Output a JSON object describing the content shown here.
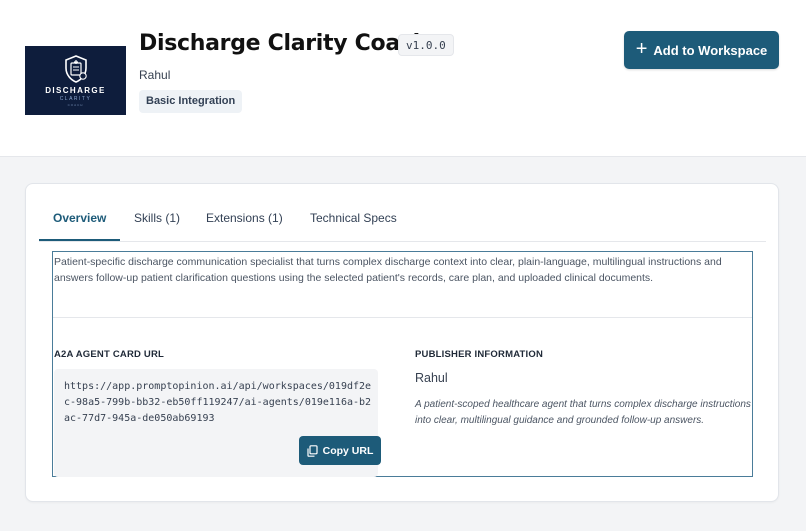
{
  "header": {
    "logo": {
      "line1": "DISCHARGE",
      "line2": "CLARITY",
      "line3": "COACH",
      "icon": "shield-document-icon"
    },
    "title": "Discharge Clarity Coach",
    "version": "v1.0.0",
    "author": "Rahul",
    "integration_badge": "Basic Integration",
    "add_button": {
      "label": "Add to Workspace",
      "icon": "plus-icon"
    }
  },
  "tabs": [
    {
      "label": "Overview",
      "active": true
    },
    {
      "label": "Skills (1)",
      "active": false
    },
    {
      "label": "Extensions (1)",
      "active": false
    },
    {
      "label": "Technical Specs",
      "active": false
    }
  ],
  "overview": {
    "description": "Patient-specific discharge communication specialist that turns complex discharge context into clear, plain-language, multilingual instructions and answers follow-up patient clarification questions using the selected patient's records, care plan, and uploaded clinical documents.",
    "agent_card": {
      "heading": "A2A AGENT CARD URL",
      "url": "https://app.promptopinion.ai/api/workspaces/019df2ec-98a5-799b-bb32-eb50ff119247/ai-agents/019e116a-b2ac-77d7-945a-de050ab69193",
      "copy_button": {
        "label": "Copy URL",
        "icon": "copy-icon"
      }
    },
    "publisher": {
      "heading": "PUBLISHER INFORMATION",
      "name": "Rahul",
      "description": "A patient-scoped healthcare agent that turns complex discharge instructions into clear, multilingual guidance and grounded follow-up answers."
    }
  },
  "colors": {
    "primary": "#1d5b79",
    "logo_background": "#0e1d3c",
    "page_background": "#f3f4f6"
  }
}
